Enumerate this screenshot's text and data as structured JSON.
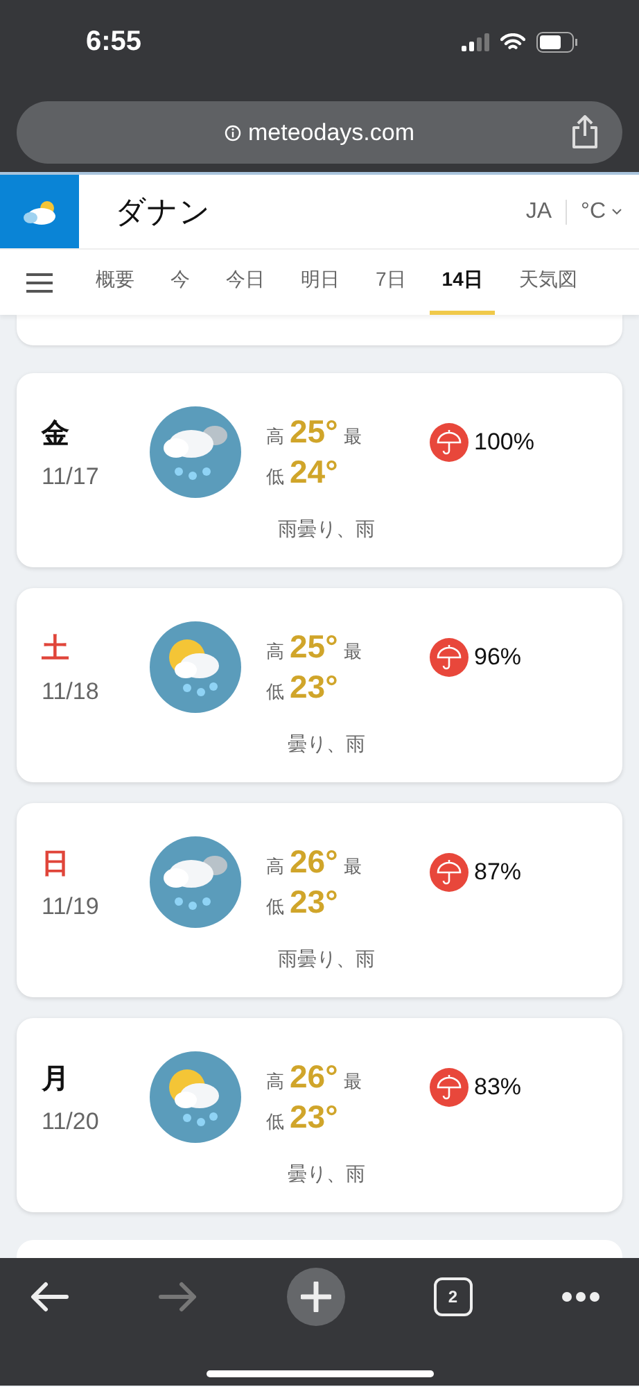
{
  "status_bar": {
    "time": "6:55"
  },
  "browser": {
    "url": "meteodays.com",
    "tab_count": "2"
  },
  "header": {
    "city": "ダナン",
    "language": "JA",
    "unit": "°C"
  },
  "tabs": [
    {
      "label": "概要",
      "selected": false
    },
    {
      "label": "今",
      "selected": false
    },
    {
      "label": "今日",
      "selected": false
    },
    {
      "label": "明日",
      "selected": false
    },
    {
      "label": "7日",
      "selected": false
    },
    {
      "label": "14日",
      "selected": true
    },
    {
      "label": "天気図",
      "selected": false
    }
  ],
  "days": [
    {
      "weekday": "金",
      "color": "#111111",
      "date": "11/17",
      "kind": "rain-cloud",
      "high_label": "高",
      "high": "25°",
      "max_label": "最",
      "low_label": "低",
      "low": "24°",
      "rain": "100%",
      "condition": "雨曇り、雨"
    },
    {
      "weekday": "土",
      "color": "#e0453a",
      "date": "11/18",
      "kind": "sun-rain",
      "high_label": "高",
      "high": "25°",
      "max_label": "最",
      "low_label": "低",
      "low": "23°",
      "rain": "96%",
      "condition": "曇り、雨"
    },
    {
      "weekday": "日",
      "color": "#e0453a",
      "date": "11/19",
      "kind": "rain-cloud",
      "high_label": "高",
      "high": "26°",
      "max_label": "最",
      "low_label": "低",
      "low": "23°",
      "rain": "87%",
      "condition": "雨曇り、雨"
    },
    {
      "weekday": "月",
      "color": "#111111",
      "date": "11/20",
      "kind": "sun-rain",
      "high_label": "高",
      "high": "26°",
      "max_label": "最",
      "low_label": "低",
      "low": "23°",
      "rain": "83%",
      "condition": "曇り、雨"
    }
  ]
}
